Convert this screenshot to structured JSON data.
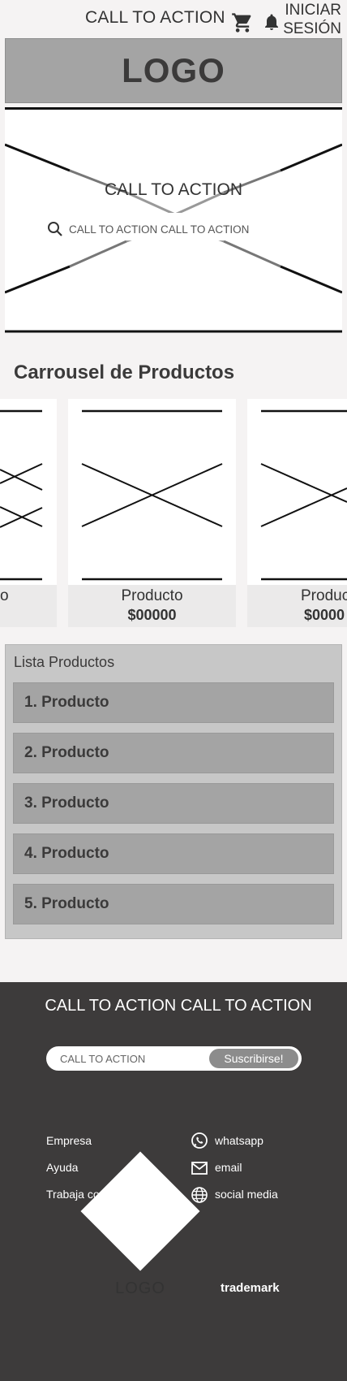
{
  "header": {
    "cta_label": "CALL TO ACTION",
    "cart_icon": "cart-icon",
    "bell_icon": "bell-icon",
    "login_line1": "INICIAR",
    "login_line2": "SESIÓN"
  },
  "logo": {
    "text": "LOGO"
  },
  "hero": {
    "cta_label": "CALL TO ACTION",
    "search_icon": "search-icon",
    "search_placeholder": "CALL TO ACTION CALL TO ACTION"
  },
  "carousel": {
    "title": "Carrousel de Productos",
    "cards": [
      {
        "name": "o",
        "price": ""
      },
      {
        "name": "Producto",
        "price": "$00000"
      },
      {
        "name": "Produc",
        "price": "$0000"
      }
    ]
  },
  "list": {
    "title": "Lista Productos",
    "items": [
      "1. Producto",
      "2. Producto",
      "3. Producto",
      "4. Producto",
      "5. Producto"
    ]
  },
  "footer": {
    "cta_label": "CALL TO ACTION CALL TO ACTION",
    "subscribe_placeholder": "CALL TO ACTION",
    "subscribe_button": "Suscribirse!",
    "links": [
      "Empresa",
      "Ayuda",
      "Trabaja con nosotros!"
    ],
    "social": [
      {
        "label": "whatsapp",
        "icon": "whatsapp-icon"
      },
      {
        "label": "email",
        "icon": "email-icon"
      },
      {
        "label": "social media",
        "icon": "globe-icon"
      }
    ],
    "logo_text": "LOGO",
    "trademark": "trademark"
  },
  "colors": {
    "page_bg": "#f5f3f3",
    "logo_bar": "#a4a4a4",
    "list_panel": "#c7c7c7",
    "list_item": "#a4a4a4",
    "footer_bg": "#3d3b3b",
    "subscribe_button": "#8c8c8c"
  }
}
